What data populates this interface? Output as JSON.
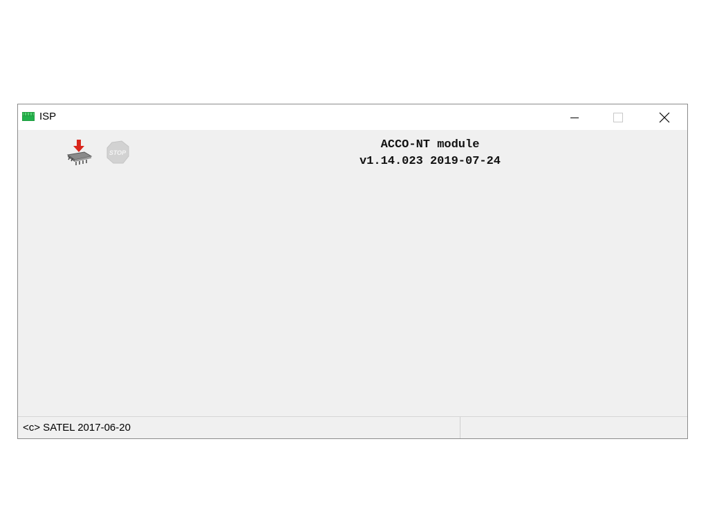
{
  "window": {
    "title": "ISP",
    "app_icon": "isp-app-icon",
    "controls": {
      "minimize": "minimize-icon",
      "maximize": "maximize-icon",
      "close": "close-icon"
    }
  },
  "toolbar": {
    "program_icon": "chip-program-icon",
    "stop_icon": "stop-icon",
    "stop_label": "STOP"
  },
  "module": {
    "name": "ACCO-NT module",
    "version": "v1.14.023 2019-07-24"
  },
  "status": {
    "copyright": "<c> SATEL 2017-06-20",
    "right_pane": ""
  },
  "colors": {
    "app_icon_green": "#22b14c",
    "client_bg": "#f0f0f0",
    "arrow_red": "#d9261c"
  }
}
